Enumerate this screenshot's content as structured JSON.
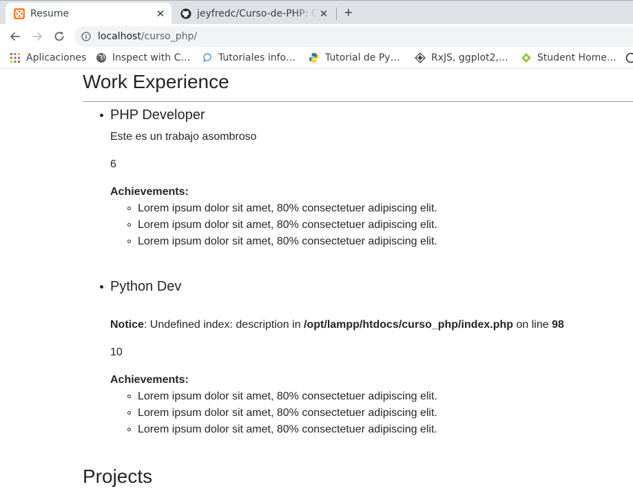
{
  "browser": {
    "tabs": [
      {
        "title": "Resume",
        "icon": "xampp-icon",
        "active": true
      },
      {
        "title": "jeyfredc/Curso-de-PHP: Cu",
        "icon": "github-icon",
        "active": false
      }
    ],
    "new_tab_label": "+",
    "close_label": "✕",
    "address": {
      "host": "localhost",
      "path": "/curso_php/"
    },
    "bookmarks": [
      {
        "label": "Aplicaciones",
        "icon": "apps-grid-icon"
      },
      {
        "label": "Inspect with C…",
        "icon": "globe-icon"
      },
      {
        "label": "Tutoriales info…",
        "icon": "bubble-icon"
      },
      {
        "label": "Tutorial de Py…",
        "icon": "python-icon"
      },
      {
        "label": "RxJS, ggplot2,…",
        "icon": "diamond-icon"
      },
      {
        "label": "Student Home…",
        "icon": "green-diamond-icon"
      }
    ]
  },
  "page": {
    "work_title": "Work Experience",
    "jobs": [
      {
        "title": "PHP Developer",
        "description": "Este es un trabajo asombroso",
        "months": "6",
        "achievements_label": "Achievements:",
        "achievements": [
          "Lorem ipsum dolor sit amet, 80% consectetuer adipiscing elit.",
          "Lorem ipsum dolor sit amet, 80% consectetuer adipiscing elit.",
          "Lorem ipsum dolor sit amet, 80% consectetuer adipiscing elit."
        ]
      },
      {
        "title": "Python Dev",
        "notice": {
          "label": "Notice",
          "message": ": Undefined index: description in ",
          "file": "/opt/lampp/htdocs/curso_php/index.php",
          "on_line": " on line ",
          "line": "98"
        },
        "months": "10",
        "achievements_label": "Achievements:",
        "achievements": [
          "Lorem ipsum dolor sit amet, 80% consectetuer adipiscing elit.",
          "Lorem ipsum dolor sit amet, 80% consectetuer adipiscing elit.",
          "Lorem ipsum dolor sit amet, 80% consectetuer adipiscing elit."
        ]
      }
    ],
    "projects_title": "Projects"
  },
  "colors": {
    "tabstrip": "#dee1e6",
    "xampp_orange": "#fb7a24",
    "text": "#212529"
  }
}
